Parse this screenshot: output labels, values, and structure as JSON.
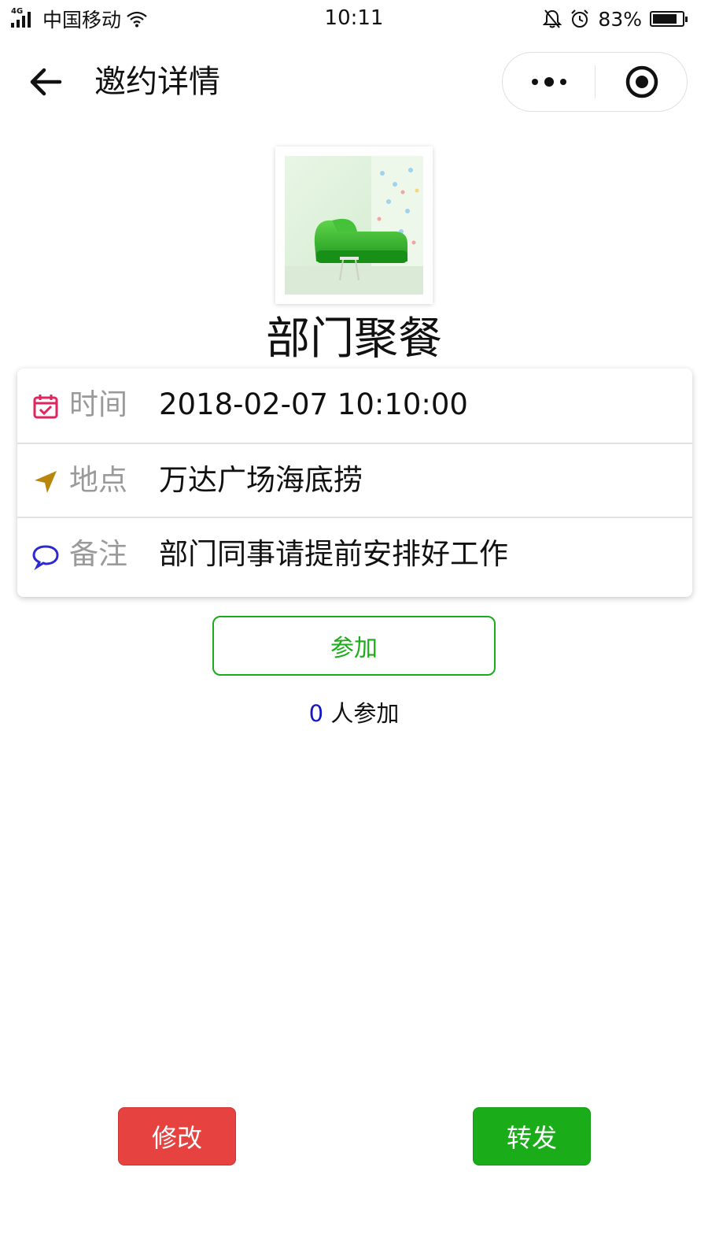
{
  "status_bar": {
    "network": "4G",
    "carrier": "中国移动",
    "time": "10:11",
    "battery": "83%",
    "battery_level": 0.83
  },
  "nav": {
    "title": "邀约详情"
  },
  "event": {
    "title": "部门聚餐",
    "details": [
      {
        "label": "时间",
        "value": "2018-02-07 10:10:00",
        "icon": "calendar-icon",
        "icon_color": "#e0245e"
      },
      {
        "label": "地点",
        "value": "万达广场海底捞",
        "icon": "location-arrow-icon",
        "icon_color": "#b8860b"
      },
      {
        "label": "备注",
        "value": "部门同事请提前安排好工作",
        "icon": "comment-icon",
        "icon_color": "#2a2ad0"
      }
    ]
  },
  "join": {
    "button_label": "参加",
    "count": "0",
    "count_suffix": "人参加"
  },
  "actions": {
    "edit_label": "修改",
    "share_label": "转发"
  },
  "colors": {
    "primary_green": "#1aad19",
    "danger_red": "#e64340",
    "count_blue": "#1414c8"
  }
}
